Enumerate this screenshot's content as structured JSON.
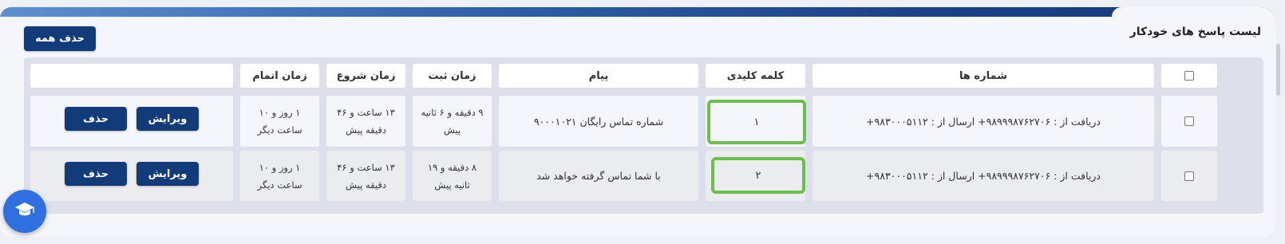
{
  "panel": {
    "title": "لیست پاسخ های خودکار",
    "delete_all_label": "حذف همه"
  },
  "table": {
    "headers": {
      "numbers": "شماره ها",
      "keyword": "کلمه کلیدی",
      "message": "پیام",
      "registered": "زمان ثبت",
      "start": "زمان شروع",
      "end": "زمان اتمام",
      "actions": ""
    },
    "rows": [
      {
        "numbers": "دریافت از : ۹۸۹۹۹۸۷۶۲۷۰۶+ ارسال از : ۹۸۳۰۰۰۵۱۱۲+",
        "keyword": "۱",
        "message": "شماره تماس رایگان ۹۰۰۰۱۰۲۱",
        "registered": "۹ دقیقه و ۶ ثانیه پیش",
        "start": "۱۳ ساعت و ۴۶ دقیقه پیش",
        "end": "۱ روز و ۱۰ ساعت دیگر",
        "edit_label": "ویرایش",
        "delete_label": "حذف"
      },
      {
        "numbers": "دریافت از : ۹۸۹۹۹۸۷۶۲۷۰۶+ ارسال از : ۹۸۳۰۰۰۵۱۱۲+",
        "keyword": "۲",
        "message": "با شما تماس گرفته خواهد شد",
        "registered": "۸ دقیقه و ۱۹ ثانیه پیش",
        "start": "۱۳ ساعت و ۴۶ دقیقه پیش",
        "end": "۱ روز و ۱۰ ساعت دیگر",
        "edit_label": "ویرایش",
        "delete_label": "حذف"
      }
    ]
  },
  "fab": {
    "icon": "graduation-cap-icon"
  },
  "colors": {
    "primary": "#123b7a",
    "keyword_border": "#6cbf4c",
    "fab": "#2f6fe0"
  }
}
